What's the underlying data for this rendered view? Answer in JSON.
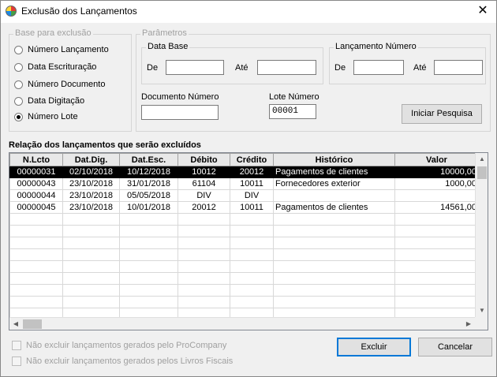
{
  "window": {
    "title": "Exclusão dos Lançamentos",
    "close_symbol": "✕"
  },
  "base_group": {
    "title": "Base para exclusão",
    "options": [
      "Número Lançamento",
      "Data Escrituração",
      "Número Documento",
      "Data Digitação",
      "Número Lote"
    ],
    "selected_index": 4
  },
  "params_group": {
    "title": "Parâmetros",
    "data_base": {
      "title": "Data Base",
      "de_label": "De",
      "ate_label": "Até",
      "de_value": "",
      "ate_value": ""
    },
    "lancamento": {
      "title": "Lançamento Número",
      "de_label": "De",
      "ate_label": "Até",
      "de_value": "",
      "ate_value": ""
    },
    "documento_label": "Documento Número",
    "documento_value": "",
    "lote_label": "Lote Número",
    "lote_value": "00001",
    "search_button": "Iniciar Pesquisa"
  },
  "grid": {
    "caption": "Relação dos lançamentos que serão excluídos",
    "columns": [
      "N.Lcto",
      "Dat.Dig.",
      "Dat.Esc.",
      "Débito",
      "Crédito",
      "Histórico",
      "Valor"
    ],
    "rows": [
      [
        "00000031",
        "02/10/2018",
        "10/12/2018",
        "10012",
        "20012",
        "Pagamentos de clientes",
        "10000,00"
      ],
      [
        "00000043",
        "23/10/2018",
        "31/01/2018",
        "61104",
        "10011",
        "Fornecedores exterior",
        "1000,00"
      ],
      [
        "00000044",
        "23/10/2018",
        "05/05/2018",
        "DIV",
        "DIV",
        "",
        ""
      ],
      [
        "00000045",
        "23/10/2018",
        "10/01/2018",
        "20012",
        "10011",
        "Pagamentos de clientes",
        "14561,00"
      ]
    ],
    "selected_row": 0,
    "empty_rows": 10
  },
  "options": {
    "cb1": "Não excluir lançamentos gerados pelo ProCompany",
    "cb2": "Não excluir lançamentos gerados pelos Livros Fiscais"
  },
  "buttons": {
    "excluir": "Excluir",
    "cancelar": "Cancelar"
  }
}
